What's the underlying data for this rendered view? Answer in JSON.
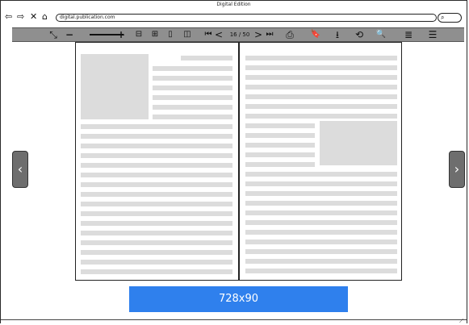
{
  "window": {
    "title": "Digital Edition"
  },
  "browser": {
    "url": "digital.publication.com",
    "icons": [
      "back-arrow-icon",
      "forward-arrow-icon",
      "close-icon",
      "home-icon",
      "search-icon"
    ]
  },
  "toolbar": {
    "fullscreen_icon": "⤡",
    "zoom_out": "−",
    "zoom_in": "+",
    "zoom_fit_icon": "⊟",
    "zoom_full_icon": "⊞",
    "single_page_icon": "▯",
    "double_page_icon": "◫",
    "first_page": "⏮",
    "prev_page": "<",
    "page_indicator": "16 / 50",
    "next_page": ">",
    "last_page": "⏭",
    "print_icon": "⎙",
    "bookmark_icon": "🔖",
    "download_icon": "⭳",
    "share_icon": "⟲",
    "search_icon": "🔍",
    "toc_icon": "≣",
    "menu_icon": "☰"
  },
  "nav": {
    "prev_label": "‹",
    "next_label": "›"
  },
  "ad": {
    "label": "728x90"
  }
}
